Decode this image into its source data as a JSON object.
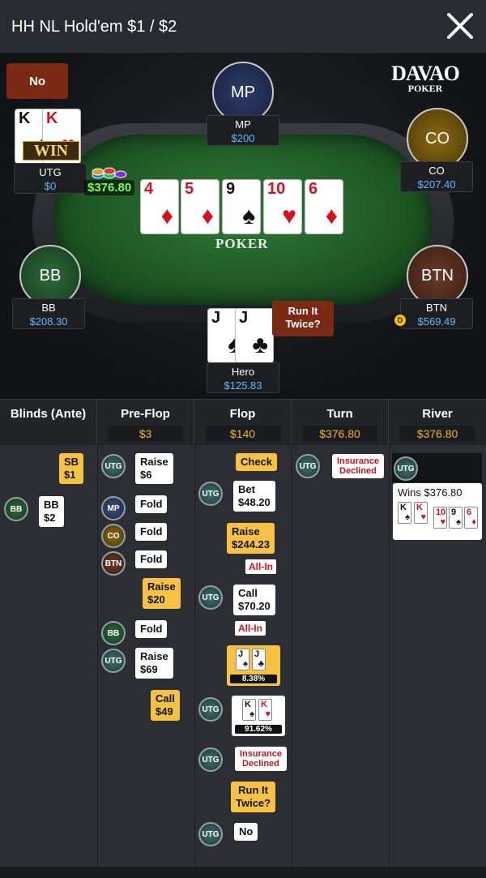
{
  "header": {
    "title": "HH NL Hold'em $1 / $2"
  },
  "brand": {
    "line1": "DAVAO",
    "line2": "POKER"
  },
  "table": {
    "felt_logo": "POKER",
    "pot": "$376.80",
    "win_tag": "WIN",
    "bubble_no": "No",
    "bubble_rit": "Run It Twice?",
    "dealer_button": "D"
  },
  "seats": {
    "mp": {
      "abbr": "MP",
      "name": "MP",
      "stack": "$200"
    },
    "co": {
      "abbr": "CO",
      "name": "CO",
      "stack": "$207.40"
    },
    "utg": {
      "name": "UTG",
      "stack": "$0",
      "cards": [
        {
          "rank": "K",
          "suit": "♠"
        },
        {
          "rank": "K",
          "suit": "♥"
        }
      ]
    },
    "bb": {
      "abbr": "BB",
      "name": "BB",
      "stack": "$208.30"
    },
    "btn": {
      "abbr": "BTN",
      "name": "BTN",
      "stack": "$569.49"
    },
    "hero": {
      "name": "Hero",
      "stack": "$125.83",
      "cards": [
        {
          "rank": "J",
          "suit": "♠"
        },
        {
          "rank": "J",
          "suit": "♣"
        }
      ]
    }
  },
  "board": [
    {
      "rank": "4",
      "suit": "♦"
    },
    {
      "rank": "5",
      "suit": "♦"
    },
    {
      "rank": "9",
      "suit": "♠"
    },
    {
      "rank": "10",
      "suit": "♥"
    },
    {
      "rank": "6",
      "suit": "♦"
    }
  ],
  "streets": [
    {
      "label": "Blinds (Ante)",
      "amount": ""
    },
    {
      "label": "Pre-Flop",
      "amount": "$3"
    },
    {
      "label": "Flop",
      "amount": "$140"
    },
    {
      "label": "Turn",
      "amount": "$376.80"
    },
    {
      "label": "River",
      "amount": "$376.80"
    }
  ],
  "actions": {
    "blinds": {
      "sb": "SB\n$1",
      "bb_pos": "BB",
      "bb": "BB\n$2"
    },
    "preflop": [
      {
        "pos": "UTG",
        "text": "Raise\n$6"
      },
      {
        "pos": "MP",
        "text": "Fold"
      },
      {
        "pos": "CO",
        "text": "Fold"
      },
      {
        "pos": "BTN",
        "text": "Fold"
      },
      {
        "pos": "",
        "text": "Raise\n$20"
      },
      {
        "pos": "BB",
        "text": "Fold"
      },
      {
        "pos": "UTG",
        "text": "Raise\n$69"
      },
      {
        "pos": "",
        "text": "Call\n$49"
      }
    ],
    "flop": {
      "check": "Check",
      "bet": "Bet\n$48.20",
      "raise": "Raise\n$244.23",
      "allin1": "All-In",
      "call": "Call\n$70.20",
      "allin2": "All-In",
      "hero_equity": "8.38%",
      "utg_equity": "91.62%",
      "insurance": "Insurance\nDeclined",
      "rit": "Run It\nTwice?",
      "no": "No"
    },
    "turn": {
      "insurance": "Insurance\nDeclined"
    },
    "river": {
      "wins": "Wins $376.80"
    }
  },
  "position_labels": {
    "utg": "UTG",
    "mp": "MP",
    "co": "CO",
    "btn": "BTN",
    "bb": "BB"
  },
  "colors": {
    "felt": "#1f5a26",
    "stack": "#67b7ff",
    "pot": "#7cfc5a",
    "yellow_action": "#f6c244",
    "red_text": "#c0161c"
  }
}
